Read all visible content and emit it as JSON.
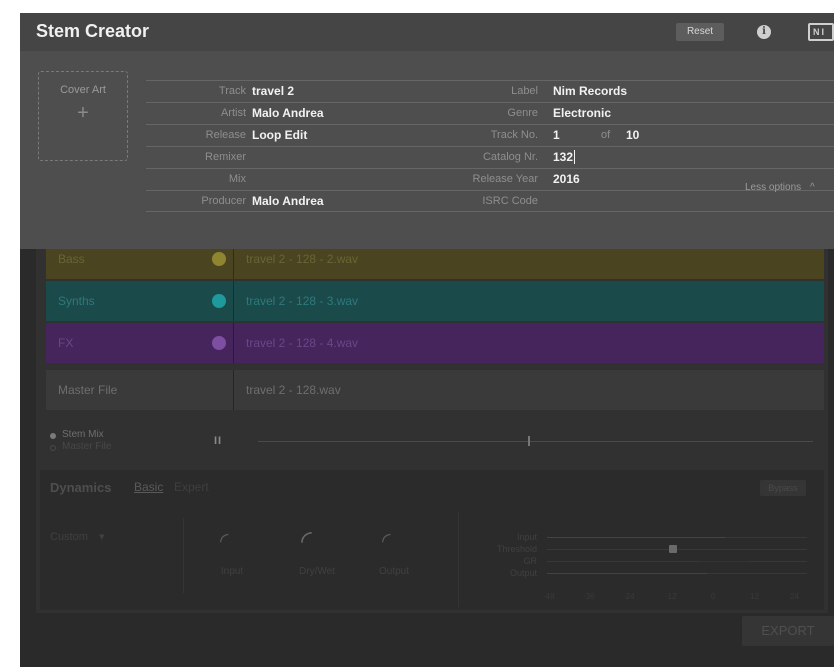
{
  "app": {
    "title": "Stem Creator",
    "reset_label": "Reset",
    "info_glyph": "i",
    "logo_text": "NI"
  },
  "metadata": {
    "cover_label": "Cover Art",
    "cover_plus": "+",
    "rows": [
      {
        "left_label": "Track",
        "left_value": "travel 2",
        "right_label": "Label",
        "right_value": "Nim Records"
      },
      {
        "left_label": "Artist",
        "left_value": "Malo Andrea",
        "right_label": "Genre",
        "right_value": "Electronic"
      },
      {
        "left_label": "Release",
        "left_value": "Loop Edit",
        "right_label": "Track No.",
        "right_value": "1",
        "of_label": "of",
        "of_value": "10"
      },
      {
        "left_label": "Remixer",
        "left_value": "",
        "right_label": "Catalog Nr.",
        "right_value": "132"
      },
      {
        "left_label": "Mix",
        "left_value": "",
        "right_label": "Release Year",
        "right_value": "2016"
      },
      {
        "left_label": "Producer",
        "left_value": "Malo Andrea",
        "right_label": "ISRC Code",
        "right_value": ""
      }
    ],
    "less_options_label": "Less options",
    "less_options_glyph": "^"
  },
  "stems": [
    {
      "name": "Bass",
      "file": "travel 2 - 128 - 2.wav",
      "color": "#8f8530"
    },
    {
      "name": "Synths",
      "file": "travel 2 - 128 - 3.wav",
      "color": "#1f9a9c"
    },
    {
      "name": "FX",
      "file": "travel 2 - 128 - 4.wav",
      "color": "#7e4ea3"
    }
  ],
  "master": {
    "name": "Master File",
    "file": "travel 2 - 128.wav"
  },
  "transport": {
    "stem_mix_label": "Stem Mix",
    "master_file_label": "Master File",
    "pause_glyph": "II"
  },
  "dynamics": {
    "title": "Dynamics",
    "tab_basic": "Basic",
    "tab_expert": "Expert",
    "bypass_label": "Bypass",
    "preset_label": "Custom",
    "preset_glyph": "▾",
    "knobs": [
      {
        "label": "Input",
        "icon": "knob-icon"
      },
      {
        "label": "Dry/Wet",
        "icon": "knob-icon"
      },
      {
        "label": "Output",
        "icon": "knob-icon"
      }
    ],
    "meter_labels": [
      "Input",
      "Threshold",
      "GR",
      "Output"
    ],
    "scale": [
      "-48",
      "-36",
      "-24",
      "-12",
      "0",
      "12",
      "24"
    ]
  },
  "export_label": "EXPORT"
}
